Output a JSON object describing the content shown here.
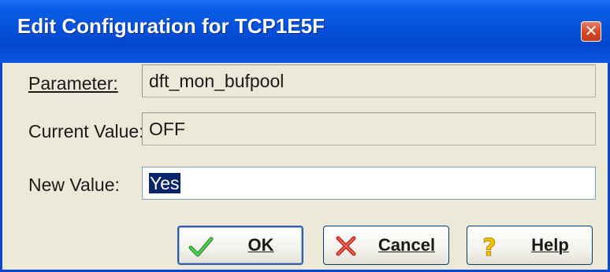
{
  "dialog": {
    "title": "Edit Configuration for TCP1E5F",
    "close_glyph": "✕"
  },
  "parameter": {
    "label": "Parameter:",
    "value": "dft_mon_bufpool"
  },
  "current_value": {
    "label": "Current Value:",
    "value": "OFF"
  },
  "new_value": {
    "label": "New Value:",
    "value": "Yes"
  },
  "buttons": {
    "ok": {
      "label": "OK",
      "icon": "checkmark-icon"
    },
    "cancel": {
      "label": "Cancel",
      "icon": "red-x-icon"
    },
    "help": {
      "label": "Help",
      "icon": "question-mark-icon"
    }
  },
  "colors": {
    "titlebar": "#0653dc",
    "selection": "#0a246a",
    "dialog_bg": "#ece9d8"
  }
}
